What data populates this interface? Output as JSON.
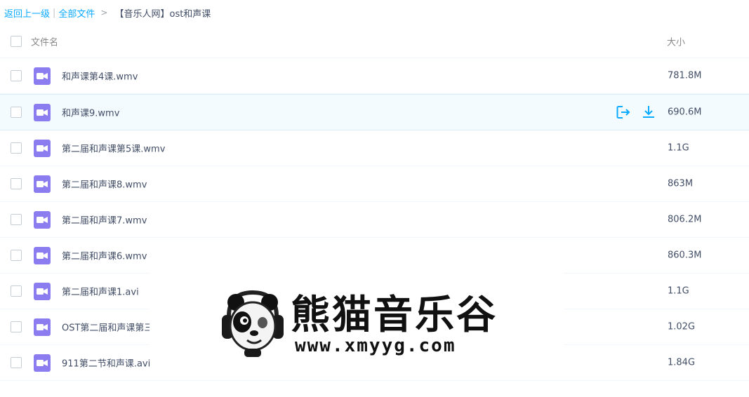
{
  "breadcrumb": {
    "back": "返回上一级",
    "separator": "|",
    "all_files": "全部文件",
    "arrow": ">",
    "current": "【音乐人网】ost和声课"
  },
  "header": {
    "name_col": "文件名",
    "size_col": "大小"
  },
  "files": [
    {
      "name": "和声课第4课.wmv",
      "size": "781.8M"
    },
    {
      "name": "和声课9.wmv",
      "size": "690.6M"
    },
    {
      "name": "第二届和声课第5课.wmv",
      "size": "1.1G"
    },
    {
      "name": "第二届和声课8.wmv",
      "size": "863M"
    },
    {
      "name": "第二届和声课7.wmv",
      "size": "806.2M"
    },
    {
      "name": "第二届和声课6.wmv",
      "size": "860.3M"
    },
    {
      "name": "第二届和声课1.avi",
      "size": "1.1G"
    },
    {
      "name": "OST第二届和声课第三",
      "size": "1.02G"
    },
    {
      "name": "911第二节和声课.avi",
      "size": "1.84G"
    }
  ],
  "row_actions": {
    "share_icon": "share-icon",
    "download_icon": "download-icon"
  },
  "watermark": {
    "title": "熊猫音乐谷",
    "url": "www.xmyyg.com"
  },
  "colors": {
    "accent": "#09aaff",
    "video_icon": "#8b7cf0",
    "hover_row": "#f4fbff"
  }
}
